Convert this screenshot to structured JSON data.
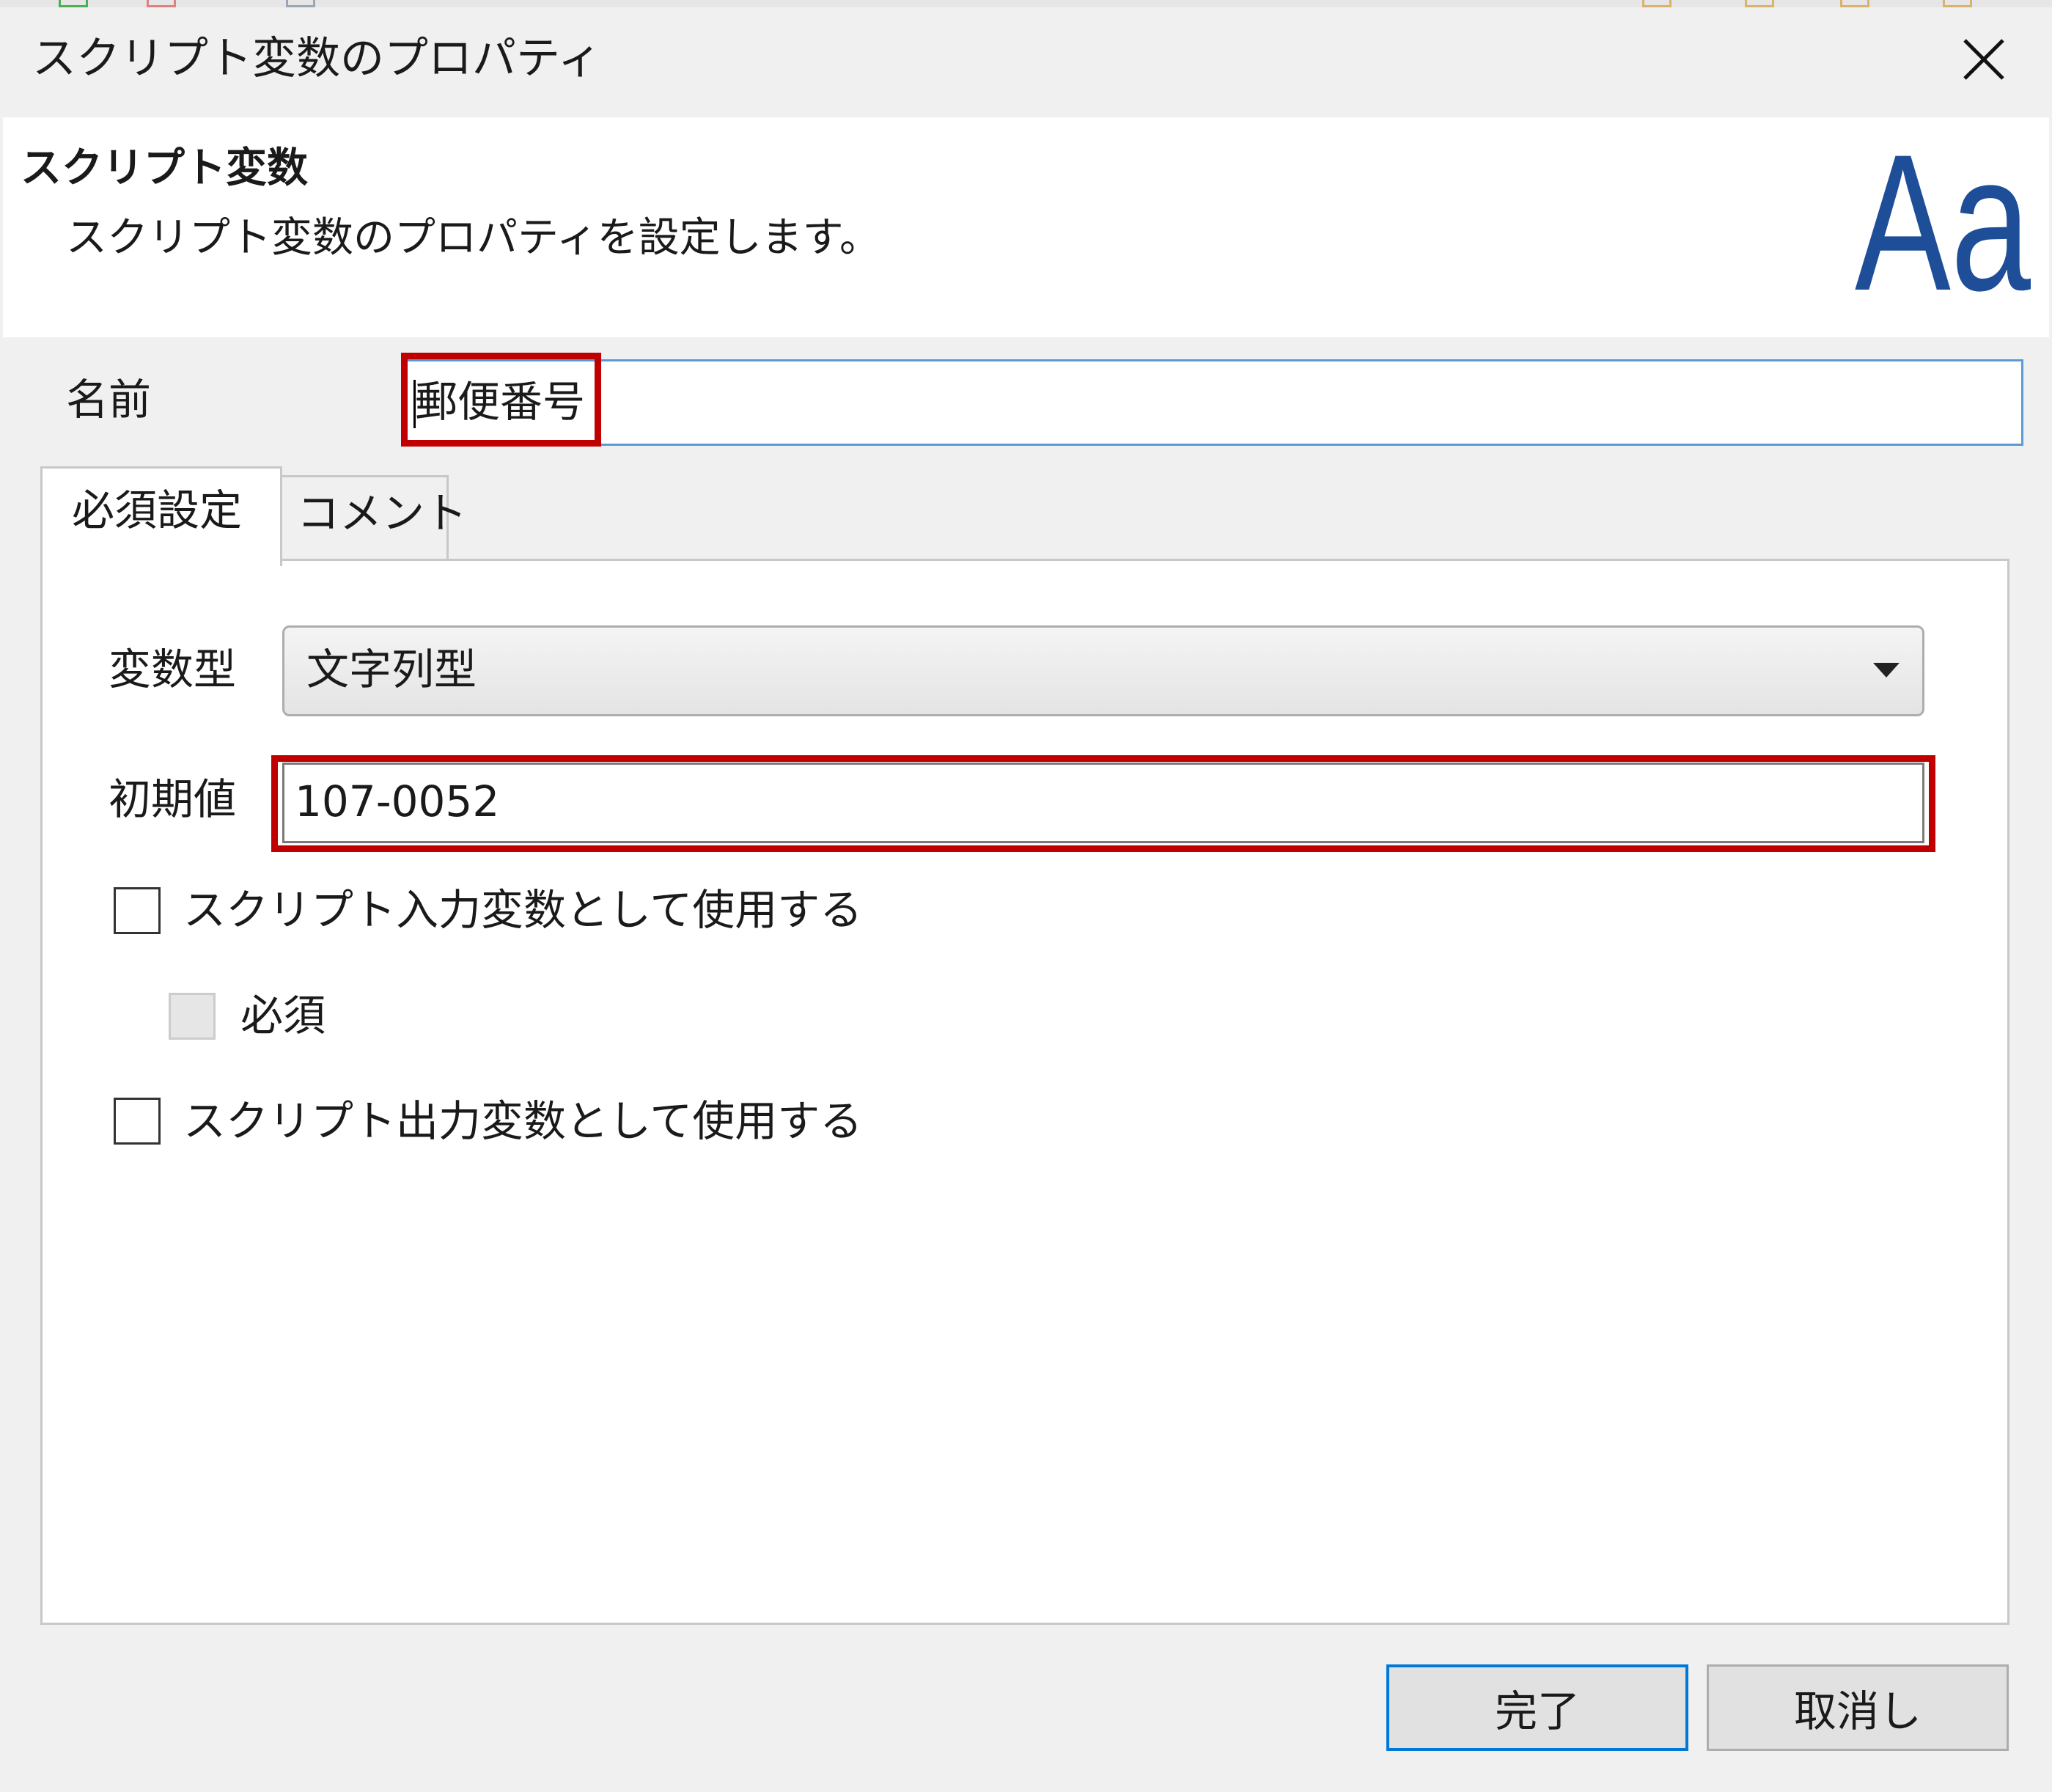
{
  "dialog": {
    "title": "スクリプト変数のプロパティ",
    "header_title": "スクリプト変数",
    "header_description": "スクリプト変数のプロパティを設定します。",
    "logo_text": "Aa"
  },
  "name": {
    "label": "名前",
    "value": "郵便番号"
  },
  "tabs": [
    {
      "label": "必須設定",
      "active": true
    },
    {
      "label": "コメント",
      "active": false
    }
  ],
  "variable_type": {
    "label": "変数型",
    "value": "文字列型"
  },
  "initial_value": {
    "label": "初期値",
    "value": "107-0052"
  },
  "checkboxes": {
    "input_var": {
      "label": "スクリプト入力変数として使用する",
      "checked": false
    },
    "required": {
      "label": "必須",
      "checked": false,
      "disabled": true
    },
    "output_var": {
      "label": "スクリプト出力変数として使用する",
      "checked": false
    }
  },
  "buttons": {
    "ok": "完了",
    "cancel": "取消し"
  },
  "colors": {
    "highlight": "#c00000",
    "focus_border": "#5b9bd5",
    "logo": "#1f4e99"
  }
}
